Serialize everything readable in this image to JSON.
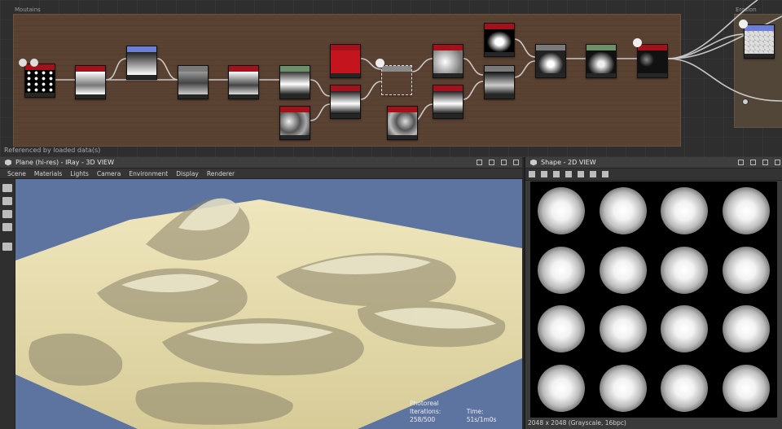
{
  "graph": {
    "frame_main_title": "Moutains",
    "frame_erosion_title": "Erosion",
    "referenced_text": "Referenced by loaded data(s)"
  },
  "panel3d": {
    "title": "Plane (hi-res) - IRay - 3D VIEW",
    "menu": [
      "Scene",
      "Materials",
      "Lights",
      "Camera",
      "Environment",
      "Display",
      "Renderer"
    ],
    "render_mode": "Photoreal",
    "iterations": "Iterations: 258/500",
    "time": "Time: 51s/1m0s"
  },
  "panel2d": {
    "title": "Shape - 2D VIEW",
    "resolution_text": "2048 x 2048 (Grayscale, 16bpc)",
    "grid": {
      "rows": 4,
      "cols": 4
    }
  },
  "colors": {
    "frame_main": "#5a4232",
    "node_header_red": "#a3121b",
    "node_header_grey": "#7a7a7a",
    "node_header_green": "#6d8f6a",
    "node_header_blue": "#6c7ed8",
    "viewport_sky": "#5d73a0",
    "terrain": "#d8cfa3"
  }
}
